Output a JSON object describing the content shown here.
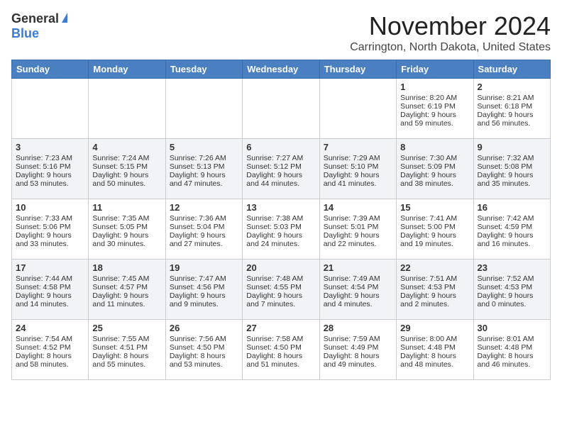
{
  "header": {
    "logo_general": "General",
    "logo_blue": "Blue",
    "month_title": "November 2024",
    "location": "Carrington, North Dakota, United States"
  },
  "weekdays": [
    "Sunday",
    "Monday",
    "Tuesday",
    "Wednesday",
    "Thursday",
    "Friday",
    "Saturday"
  ],
  "weeks": [
    [
      {
        "day": "",
        "info": ""
      },
      {
        "day": "",
        "info": ""
      },
      {
        "day": "",
        "info": ""
      },
      {
        "day": "",
        "info": ""
      },
      {
        "day": "",
        "info": ""
      },
      {
        "day": "1",
        "info": "Sunrise: 8:20 AM\nSunset: 6:19 PM\nDaylight: 9 hours and 59 minutes."
      },
      {
        "day": "2",
        "info": "Sunrise: 8:21 AM\nSunset: 6:18 PM\nDaylight: 9 hours and 56 minutes."
      }
    ],
    [
      {
        "day": "3",
        "info": "Sunrise: 7:23 AM\nSunset: 5:16 PM\nDaylight: 9 hours and 53 minutes."
      },
      {
        "day": "4",
        "info": "Sunrise: 7:24 AM\nSunset: 5:15 PM\nDaylight: 9 hours and 50 minutes."
      },
      {
        "day": "5",
        "info": "Sunrise: 7:26 AM\nSunset: 5:13 PM\nDaylight: 9 hours and 47 minutes."
      },
      {
        "day": "6",
        "info": "Sunrise: 7:27 AM\nSunset: 5:12 PM\nDaylight: 9 hours and 44 minutes."
      },
      {
        "day": "7",
        "info": "Sunrise: 7:29 AM\nSunset: 5:10 PM\nDaylight: 9 hours and 41 minutes."
      },
      {
        "day": "8",
        "info": "Sunrise: 7:30 AM\nSunset: 5:09 PM\nDaylight: 9 hours and 38 minutes."
      },
      {
        "day": "9",
        "info": "Sunrise: 7:32 AM\nSunset: 5:08 PM\nDaylight: 9 hours and 35 minutes."
      }
    ],
    [
      {
        "day": "10",
        "info": "Sunrise: 7:33 AM\nSunset: 5:06 PM\nDaylight: 9 hours and 33 minutes."
      },
      {
        "day": "11",
        "info": "Sunrise: 7:35 AM\nSunset: 5:05 PM\nDaylight: 9 hours and 30 minutes."
      },
      {
        "day": "12",
        "info": "Sunrise: 7:36 AM\nSunset: 5:04 PM\nDaylight: 9 hours and 27 minutes."
      },
      {
        "day": "13",
        "info": "Sunrise: 7:38 AM\nSunset: 5:03 PM\nDaylight: 9 hours and 24 minutes."
      },
      {
        "day": "14",
        "info": "Sunrise: 7:39 AM\nSunset: 5:01 PM\nDaylight: 9 hours and 22 minutes."
      },
      {
        "day": "15",
        "info": "Sunrise: 7:41 AM\nSunset: 5:00 PM\nDaylight: 9 hours and 19 minutes."
      },
      {
        "day": "16",
        "info": "Sunrise: 7:42 AM\nSunset: 4:59 PM\nDaylight: 9 hours and 16 minutes."
      }
    ],
    [
      {
        "day": "17",
        "info": "Sunrise: 7:44 AM\nSunset: 4:58 PM\nDaylight: 9 hours and 14 minutes."
      },
      {
        "day": "18",
        "info": "Sunrise: 7:45 AM\nSunset: 4:57 PM\nDaylight: 9 hours and 11 minutes."
      },
      {
        "day": "19",
        "info": "Sunrise: 7:47 AM\nSunset: 4:56 PM\nDaylight: 9 hours and 9 minutes."
      },
      {
        "day": "20",
        "info": "Sunrise: 7:48 AM\nSunset: 4:55 PM\nDaylight: 9 hours and 7 minutes."
      },
      {
        "day": "21",
        "info": "Sunrise: 7:49 AM\nSunset: 4:54 PM\nDaylight: 9 hours and 4 minutes."
      },
      {
        "day": "22",
        "info": "Sunrise: 7:51 AM\nSunset: 4:53 PM\nDaylight: 9 hours and 2 minutes."
      },
      {
        "day": "23",
        "info": "Sunrise: 7:52 AM\nSunset: 4:53 PM\nDaylight: 9 hours and 0 minutes."
      }
    ],
    [
      {
        "day": "24",
        "info": "Sunrise: 7:54 AM\nSunset: 4:52 PM\nDaylight: 8 hours and 58 minutes."
      },
      {
        "day": "25",
        "info": "Sunrise: 7:55 AM\nSunset: 4:51 PM\nDaylight: 8 hours and 55 minutes."
      },
      {
        "day": "26",
        "info": "Sunrise: 7:56 AM\nSunset: 4:50 PM\nDaylight: 8 hours and 53 minutes."
      },
      {
        "day": "27",
        "info": "Sunrise: 7:58 AM\nSunset: 4:50 PM\nDaylight: 8 hours and 51 minutes."
      },
      {
        "day": "28",
        "info": "Sunrise: 7:59 AM\nSunset: 4:49 PM\nDaylight: 8 hours and 49 minutes."
      },
      {
        "day": "29",
        "info": "Sunrise: 8:00 AM\nSunset: 4:48 PM\nDaylight: 8 hours and 48 minutes."
      },
      {
        "day": "30",
        "info": "Sunrise: 8:01 AM\nSunset: 4:48 PM\nDaylight: 8 hours and 46 minutes."
      }
    ]
  ]
}
